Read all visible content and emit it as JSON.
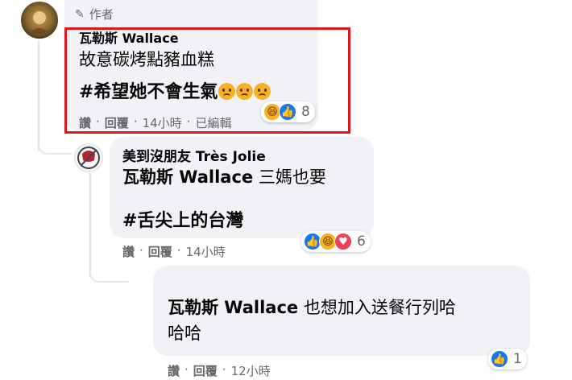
{
  "comment1": {
    "author_badge": "作者",
    "author": "瓦勒斯 Wallace",
    "text": "故意碳烤點豬血糕",
    "hashtag": "#希望她不會生氣",
    "reaction_count": "8",
    "actions": {
      "like": "讚",
      "reply": "回覆",
      "time": "14小時",
      "edited": "已編輯"
    },
    "highlight_color": "#e0161d"
  },
  "comment2": {
    "author": "美到沒朋友 Très Jolie",
    "mention": "瓦勒斯 Wallace",
    "text": "三媽也要",
    "hashtag": "#舌尖上的台灣",
    "reaction_count": "6",
    "actions": {
      "like": "讚",
      "reply": "回覆",
      "time": "14小時"
    }
  },
  "comment3": {
    "mention": "瓦勒斯 Wallace",
    "text_line1": "也想加入送餐行列哈",
    "text_line2": "哈哈",
    "reaction_count": "1",
    "actions": {
      "like": "讚",
      "reply": "回覆",
      "time": "12小時"
    }
  },
  "colors": {
    "bubble": "#f0f2f5",
    "meta": "#65676b",
    "like": "#1877f2"
  }
}
